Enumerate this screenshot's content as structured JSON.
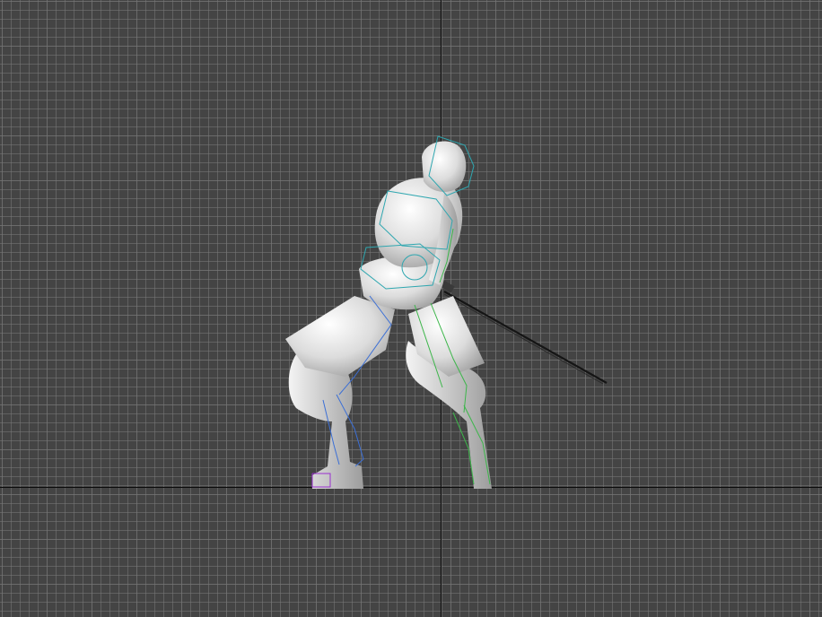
{
  "viewport": {
    "background_color": "#444444",
    "grid_major_color": "#5f5f5f",
    "grid_minor_color": "#787878",
    "axis_color": "#0a0a0a"
  },
  "character": {
    "mesh_color": "#e8e8e8",
    "bone_colors": {
      "spine": "#2fa7b0",
      "left_arm": "#3b6fd6",
      "right_leg": "#3cb64a",
      "foot": "#9a2fd0"
    },
    "sword_color": "#151515"
  }
}
